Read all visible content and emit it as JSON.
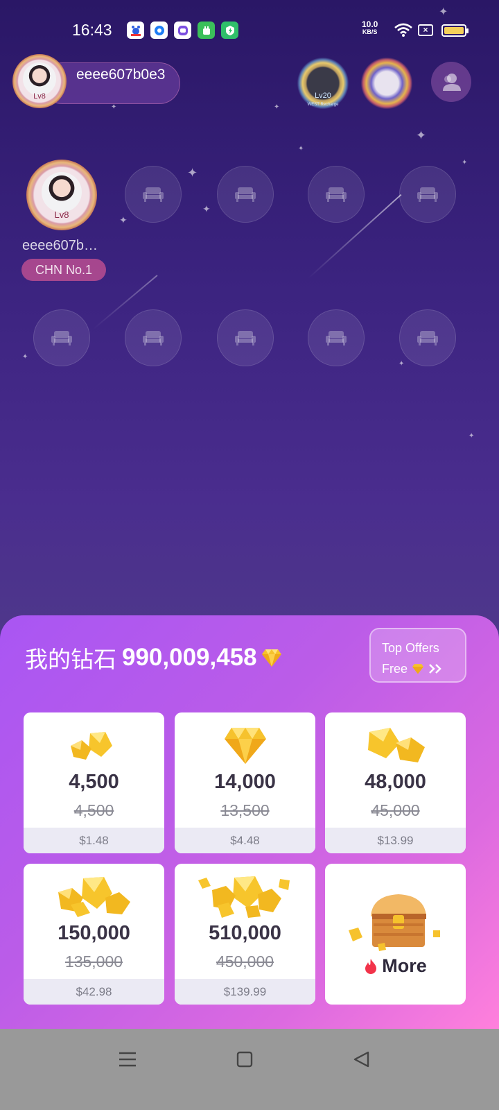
{
  "status_bar": {
    "time": "16:43",
    "net_speed_value": "10.0",
    "net_speed_unit": "KB/S",
    "battery_level": 1.0,
    "app_icons": [
      "baidu-icon",
      "browser-icon",
      "messenger-icon",
      "android-icon",
      "guard-icon"
    ]
  },
  "header": {
    "username": "eeee607b0e3",
    "avatar_level": "Lv8",
    "medal1_level": "Lv20",
    "medal1_caption": "WEST Recharge"
  },
  "room": {
    "host_name": "eeee607b…",
    "host_level": "Lv8",
    "host_tag": "CHN No.1"
  },
  "sheet": {
    "balance_label": "我的钻石",
    "balance_value": "990,009,458",
    "top_offers_line1": "Top Offers",
    "top_offers_line2": "Free",
    "packages": [
      {
        "amount": "4,500",
        "original": "4,500",
        "price": "$1.48",
        "icon": "gem-small-pile-icon"
      },
      {
        "amount": "14,000",
        "original": "13,500",
        "price": "$4.48",
        "icon": "gem-single-icon"
      },
      {
        "amount": "48,000",
        "original": "45,000",
        "price": "$13.99",
        "icon": "gem-pair-icon"
      },
      {
        "amount": "150,000",
        "original": "135,000",
        "price": "$42.98",
        "icon": "gem-pile-icon"
      },
      {
        "amount": "510,000",
        "original": "450,000",
        "price": "$139.99",
        "icon": "gem-large-pile-icon"
      }
    ],
    "more_label": "More"
  },
  "colors": {
    "accent_gold": "#f6c22d",
    "sheet_start": "#a956f3",
    "sheet_end": "#ff80dc",
    "host_tag_bg": "#e15a96"
  }
}
